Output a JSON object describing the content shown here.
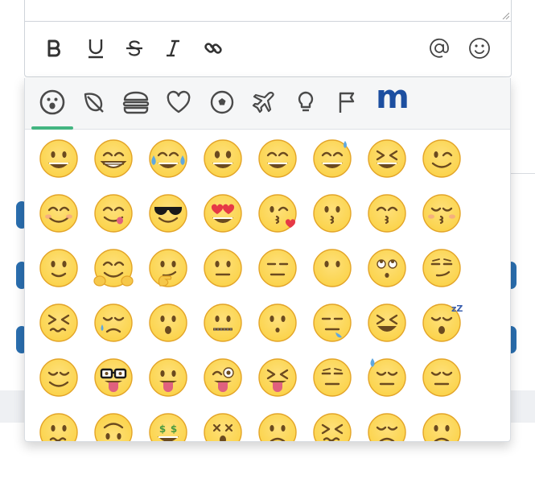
{
  "toolbar": {
    "buttons": [
      {
        "name": "bold",
        "icon": "bold-icon"
      },
      {
        "name": "underline",
        "icon": "underline-icon"
      },
      {
        "name": "strikethrough",
        "icon": "strikethrough-icon"
      },
      {
        "name": "italic",
        "icon": "italic-icon"
      },
      {
        "name": "link",
        "icon": "link-icon"
      },
      {
        "name": "mention",
        "icon": "at-icon"
      },
      {
        "name": "emoji",
        "icon": "smiley-icon"
      }
    ]
  },
  "emoji_picker": {
    "active_category": "smileys",
    "categories": [
      {
        "id": "smileys",
        "icon": "smiley-face-icon"
      },
      {
        "id": "nature",
        "icon": "leaf-icon"
      },
      {
        "id": "food",
        "icon": "burger-icon"
      },
      {
        "id": "symbols",
        "icon": "heart-icon"
      },
      {
        "id": "activity",
        "icon": "soccer-ball-icon"
      },
      {
        "id": "travel",
        "icon": "airplane-icon"
      },
      {
        "id": "objects",
        "icon": "lightbulb-icon"
      },
      {
        "id": "flags",
        "icon": "flag-icon"
      },
      {
        "id": "custom",
        "icon": "brand-m-icon",
        "label": "m"
      }
    ],
    "emojis": [
      [
        "grinning",
        "grin",
        "joy",
        "smiley",
        "smile",
        "sweat-smile",
        "laughing",
        "wink"
      ],
      [
        "blush",
        "yum",
        "sunglasses",
        "heart-eyes",
        "kissing-heart",
        "kissing",
        "kissing-smiling-eyes",
        "kissing-closed-eyes"
      ],
      [
        "slight-smile",
        "hugging",
        "thinking",
        "neutral",
        "expressionless",
        "no-mouth",
        "rolling-eyes",
        "smirk"
      ],
      [
        "persevere",
        "disappointed-relieved",
        "open-mouth",
        "zipper-mouth",
        "hushed",
        "sleepy",
        "tired",
        "sleeping"
      ],
      [
        "relieved",
        "nerd",
        "stuck-out-tongue",
        "stuck-out-tongue-winking-eye",
        "stuck-out-tongue-closed-eyes",
        "unamused",
        "sweat",
        "pensive"
      ],
      [
        "confused",
        "upside-down",
        "money-mouth",
        "astonished",
        "frowning",
        "confounded",
        "disappointed",
        "worried"
      ]
    ],
    "colors": {
      "accent": "#43b581",
      "brand": "#1d4fa0",
      "face": "#fbd34a",
      "face_edge": "#e3a428",
      "tear": "#5fa8e0",
      "tongue": "#e0607e",
      "heart": "#e63946"
    }
  }
}
